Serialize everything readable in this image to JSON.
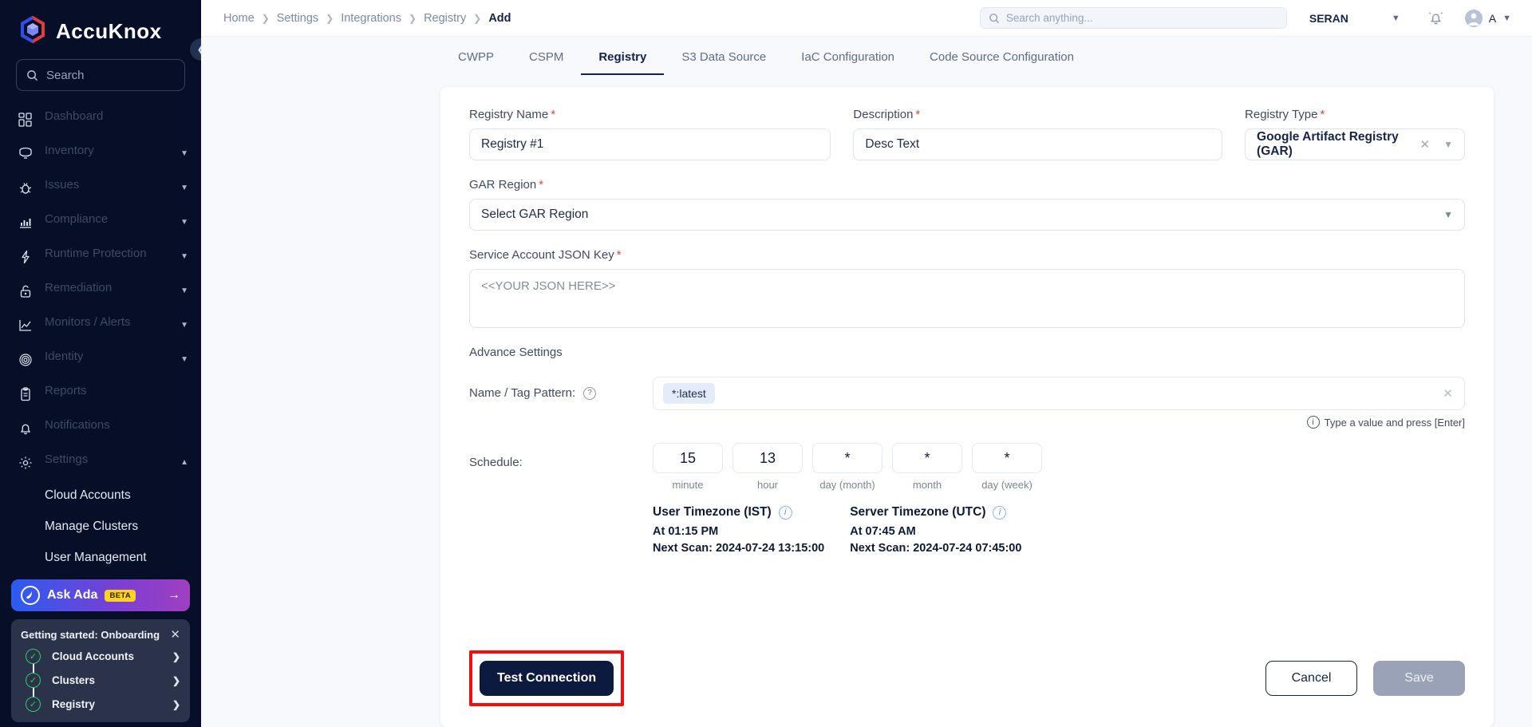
{
  "brand": {
    "name_acc": "Accu",
    "name_knox": "Knox",
    "logo_icon": "accuknox-cube-logo"
  },
  "sidebar": {
    "search_placeholder": "Search",
    "collapse_icon": "chevron-left-icon",
    "items": [
      {
        "label": "Dashboard",
        "icon": "grid-icon",
        "expandable": false
      },
      {
        "label": "Inventory",
        "icon": "inventory-icon",
        "expandable": true
      },
      {
        "label": "Issues",
        "icon": "bug-icon",
        "expandable": true
      },
      {
        "label": "Compliance",
        "icon": "bar-chart-icon",
        "expandable": true
      },
      {
        "label": "Runtime Protection",
        "icon": "lightning-icon",
        "expandable": true
      },
      {
        "label": "Remediation",
        "icon": "unlock-icon",
        "expandable": true
      },
      {
        "label": "Monitors / Alerts",
        "icon": "line-chart-icon",
        "expandable": true
      },
      {
        "label": "Identity",
        "icon": "fingerprint-icon",
        "expandable": true
      },
      {
        "label": "Reports",
        "icon": "clipboard-icon",
        "expandable": false
      },
      {
        "label": "Notifications",
        "icon": "bell-icon",
        "expandable": false
      },
      {
        "label": "Settings",
        "icon": "gear-icon",
        "expandable": true,
        "expanded": true
      }
    ],
    "settings_children": [
      {
        "label": "Cloud Accounts"
      },
      {
        "label": "Manage Clusters"
      },
      {
        "label": "User Management"
      }
    ],
    "ask_ada": {
      "label": "Ask Ada",
      "badge": "BETA",
      "arrow_icon": "arrow-right-icon",
      "logo_icon": "ada-logo-icon"
    },
    "onboarding": {
      "title": "Getting started: Onboarding",
      "close_icon": "close-icon",
      "steps": [
        {
          "label": "Cloud Accounts",
          "done": true
        },
        {
          "label": "Clusters",
          "done": true
        },
        {
          "label": "Registry",
          "done": true
        }
      ]
    }
  },
  "topbar": {
    "breadcrumbs": [
      "Home",
      "Settings",
      "Integrations",
      "Registry",
      "Add"
    ],
    "search_placeholder": "Search anything...",
    "search_icon": "search-icon",
    "org": "SERAN",
    "org_chevron": "chevron-down-icon",
    "bell_icon": "bell-ring-icon",
    "avatar_icon": "user-avatar-icon",
    "account_letter": "A",
    "account_chevron": "chevron-down-icon"
  },
  "tabs": [
    {
      "label": "CWPP",
      "active": false
    },
    {
      "label": "CSPM",
      "active": false
    },
    {
      "label": "Registry",
      "active": true
    },
    {
      "label": "S3 Data Source",
      "active": false
    },
    {
      "label": "IaC Configuration",
      "active": false
    },
    {
      "label": "Code Source Configuration",
      "active": false
    }
  ],
  "form": {
    "registry_name": {
      "label": "Registry Name",
      "required": "*",
      "value": "Registry #1"
    },
    "description": {
      "label": "Description",
      "required": "*",
      "value": "Desc Text"
    },
    "registry_type": {
      "label": "Registry Type",
      "required": "*",
      "value": "Google Artifact Registry (GAR)",
      "clear_icon": "close-icon",
      "chevron_icon": "chevron-down-icon"
    },
    "gar_region": {
      "label": "GAR Region",
      "required": "*",
      "value": "Select GAR Region",
      "chevron_icon": "chevron-down-icon"
    },
    "service_account_json": {
      "label": "Service Account JSON Key",
      "required": "*",
      "placeholder": "<<YOUR JSON HERE>>",
      "value": ""
    },
    "advance_settings_label": "Advance Settings",
    "name_tag_pattern": {
      "label": "Name / Tag Pattern:",
      "help_icon": "question-circle-icon",
      "chips": [
        "*:latest"
      ],
      "clear_icon": "close-icon",
      "hint": "Type a value and press [Enter]",
      "hint_icon": "info-circle-icon"
    },
    "schedule": {
      "label": "Schedule:",
      "cron": [
        {
          "value": "15",
          "unit": "minute"
        },
        {
          "value": "13",
          "unit": "hour"
        },
        {
          "value": "*",
          "unit": "day (month)"
        },
        {
          "value": "*",
          "unit": "month"
        },
        {
          "value": "*",
          "unit": "day (week)"
        }
      ],
      "timezones": [
        {
          "title": "User Timezone (IST)",
          "info_icon": "info-circle-icon",
          "at": "At 01:15 PM",
          "next": "Next Scan: 2024-07-24 13:15:00"
        },
        {
          "title": "Server Timezone (UTC)",
          "info_icon": "info-circle-icon",
          "at": "At 07:45 AM",
          "next": "Next Scan: 2024-07-24 07:45:00"
        }
      ]
    }
  },
  "footer": {
    "test_connection": "Test Connection",
    "cancel": "Cancel",
    "save": "Save",
    "highlight_color": "#f50c0c"
  }
}
